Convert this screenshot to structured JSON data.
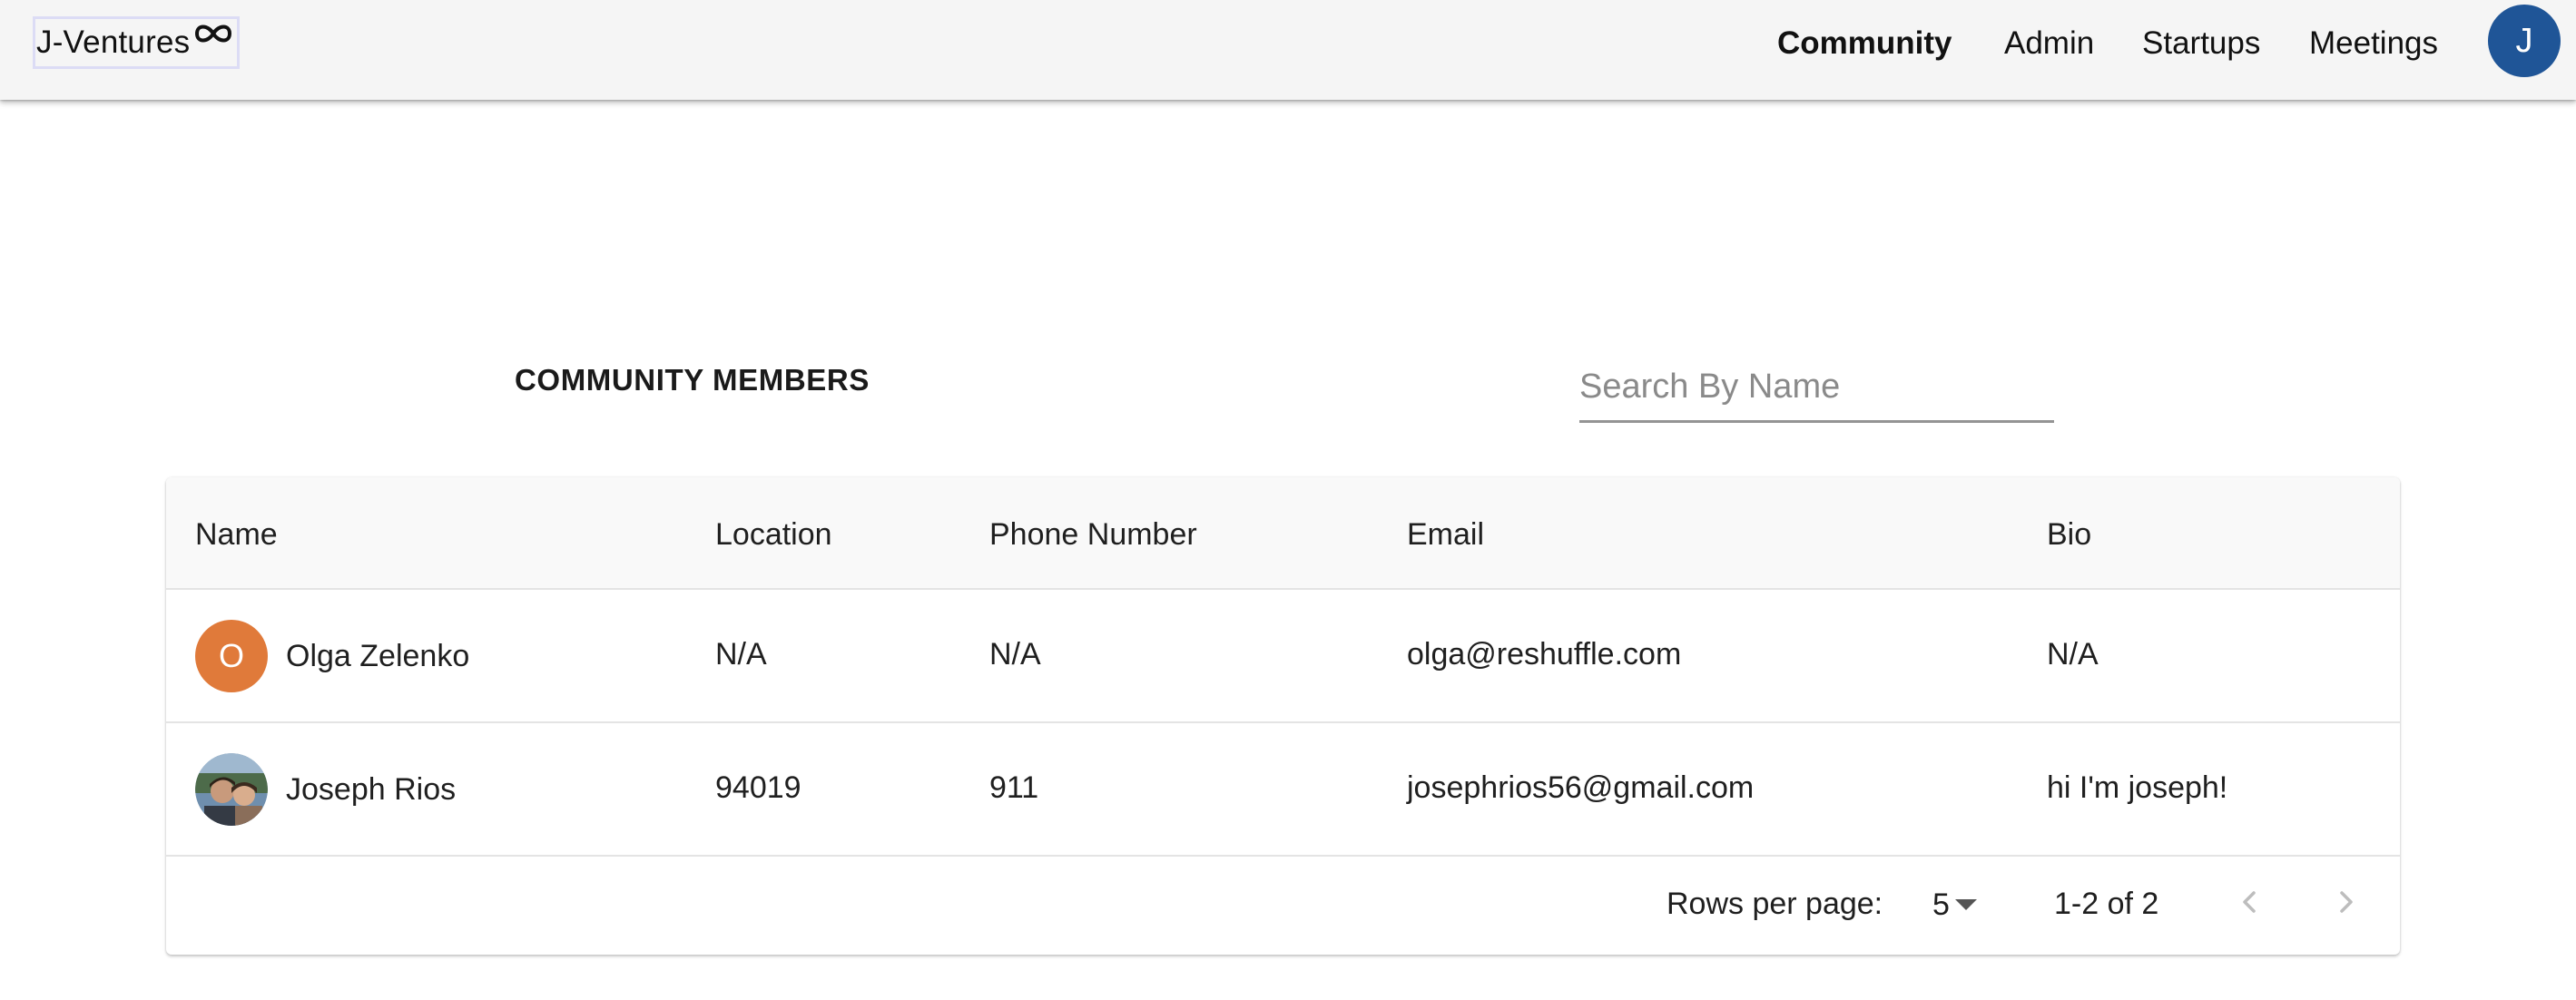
{
  "app": {
    "logo_text": "J-Ventures",
    "logo_icon": "infinity-icon"
  },
  "nav": {
    "items": [
      {
        "label": "Community",
        "active": true
      },
      {
        "label": "Admin",
        "active": false
      },
      {
        "label": "Startups",
        "active": false
      },
      {
        "label": "Meetings",
        "active": false
      }
    ],
    "user_initial": "J",
    "user_avatar_color": "#1f5597"
  },
  "page": {
    "title": "COMMUNITY MEMBERS",
    "search": {
      "placeholder": "Search By Name",
      "value": ""
    }
  },
  "table": {
    "columns": [
      "Name",
      "Location",
      "Phone Number",
      "Email",
      "Bio"
    ],
    "rows": [
      {
        "avatar_initial": "O",
        "avatar_color": "#e07a3a",
        "avatar_type": "initial",
        "name": "Olga Zelenko",
        "location": "N/A",
        "phone": "N/A",
        "email": "olga@reshuffle.com",
        "bio": "N/A"
      },
      {
        "avatar_type": "photo",
        "name": "Joseph Rios",
        "location": "94019",
        "phone": "911",
        "email": "josephrios56@gmail.com",
        "bio": "hi I'm joseph!"
      }
    ],
    "pagination": {
      "rows_per_page_label": "Rows per page:",
      "rows_per_page": "5",
      "range": "1-2 of 2",
      "prev_icon": "chevron-left-icon",
      "next_icon": "chevron-right-icon"
    }
  },
  "colors": {
    "topbar_bg": "#f5f5f5",
    "table_header_bg": "#f9f9f9",
    "accent_blue": "#1f5597",
    "avatar_orange": "#e07a3a"
  }
}
